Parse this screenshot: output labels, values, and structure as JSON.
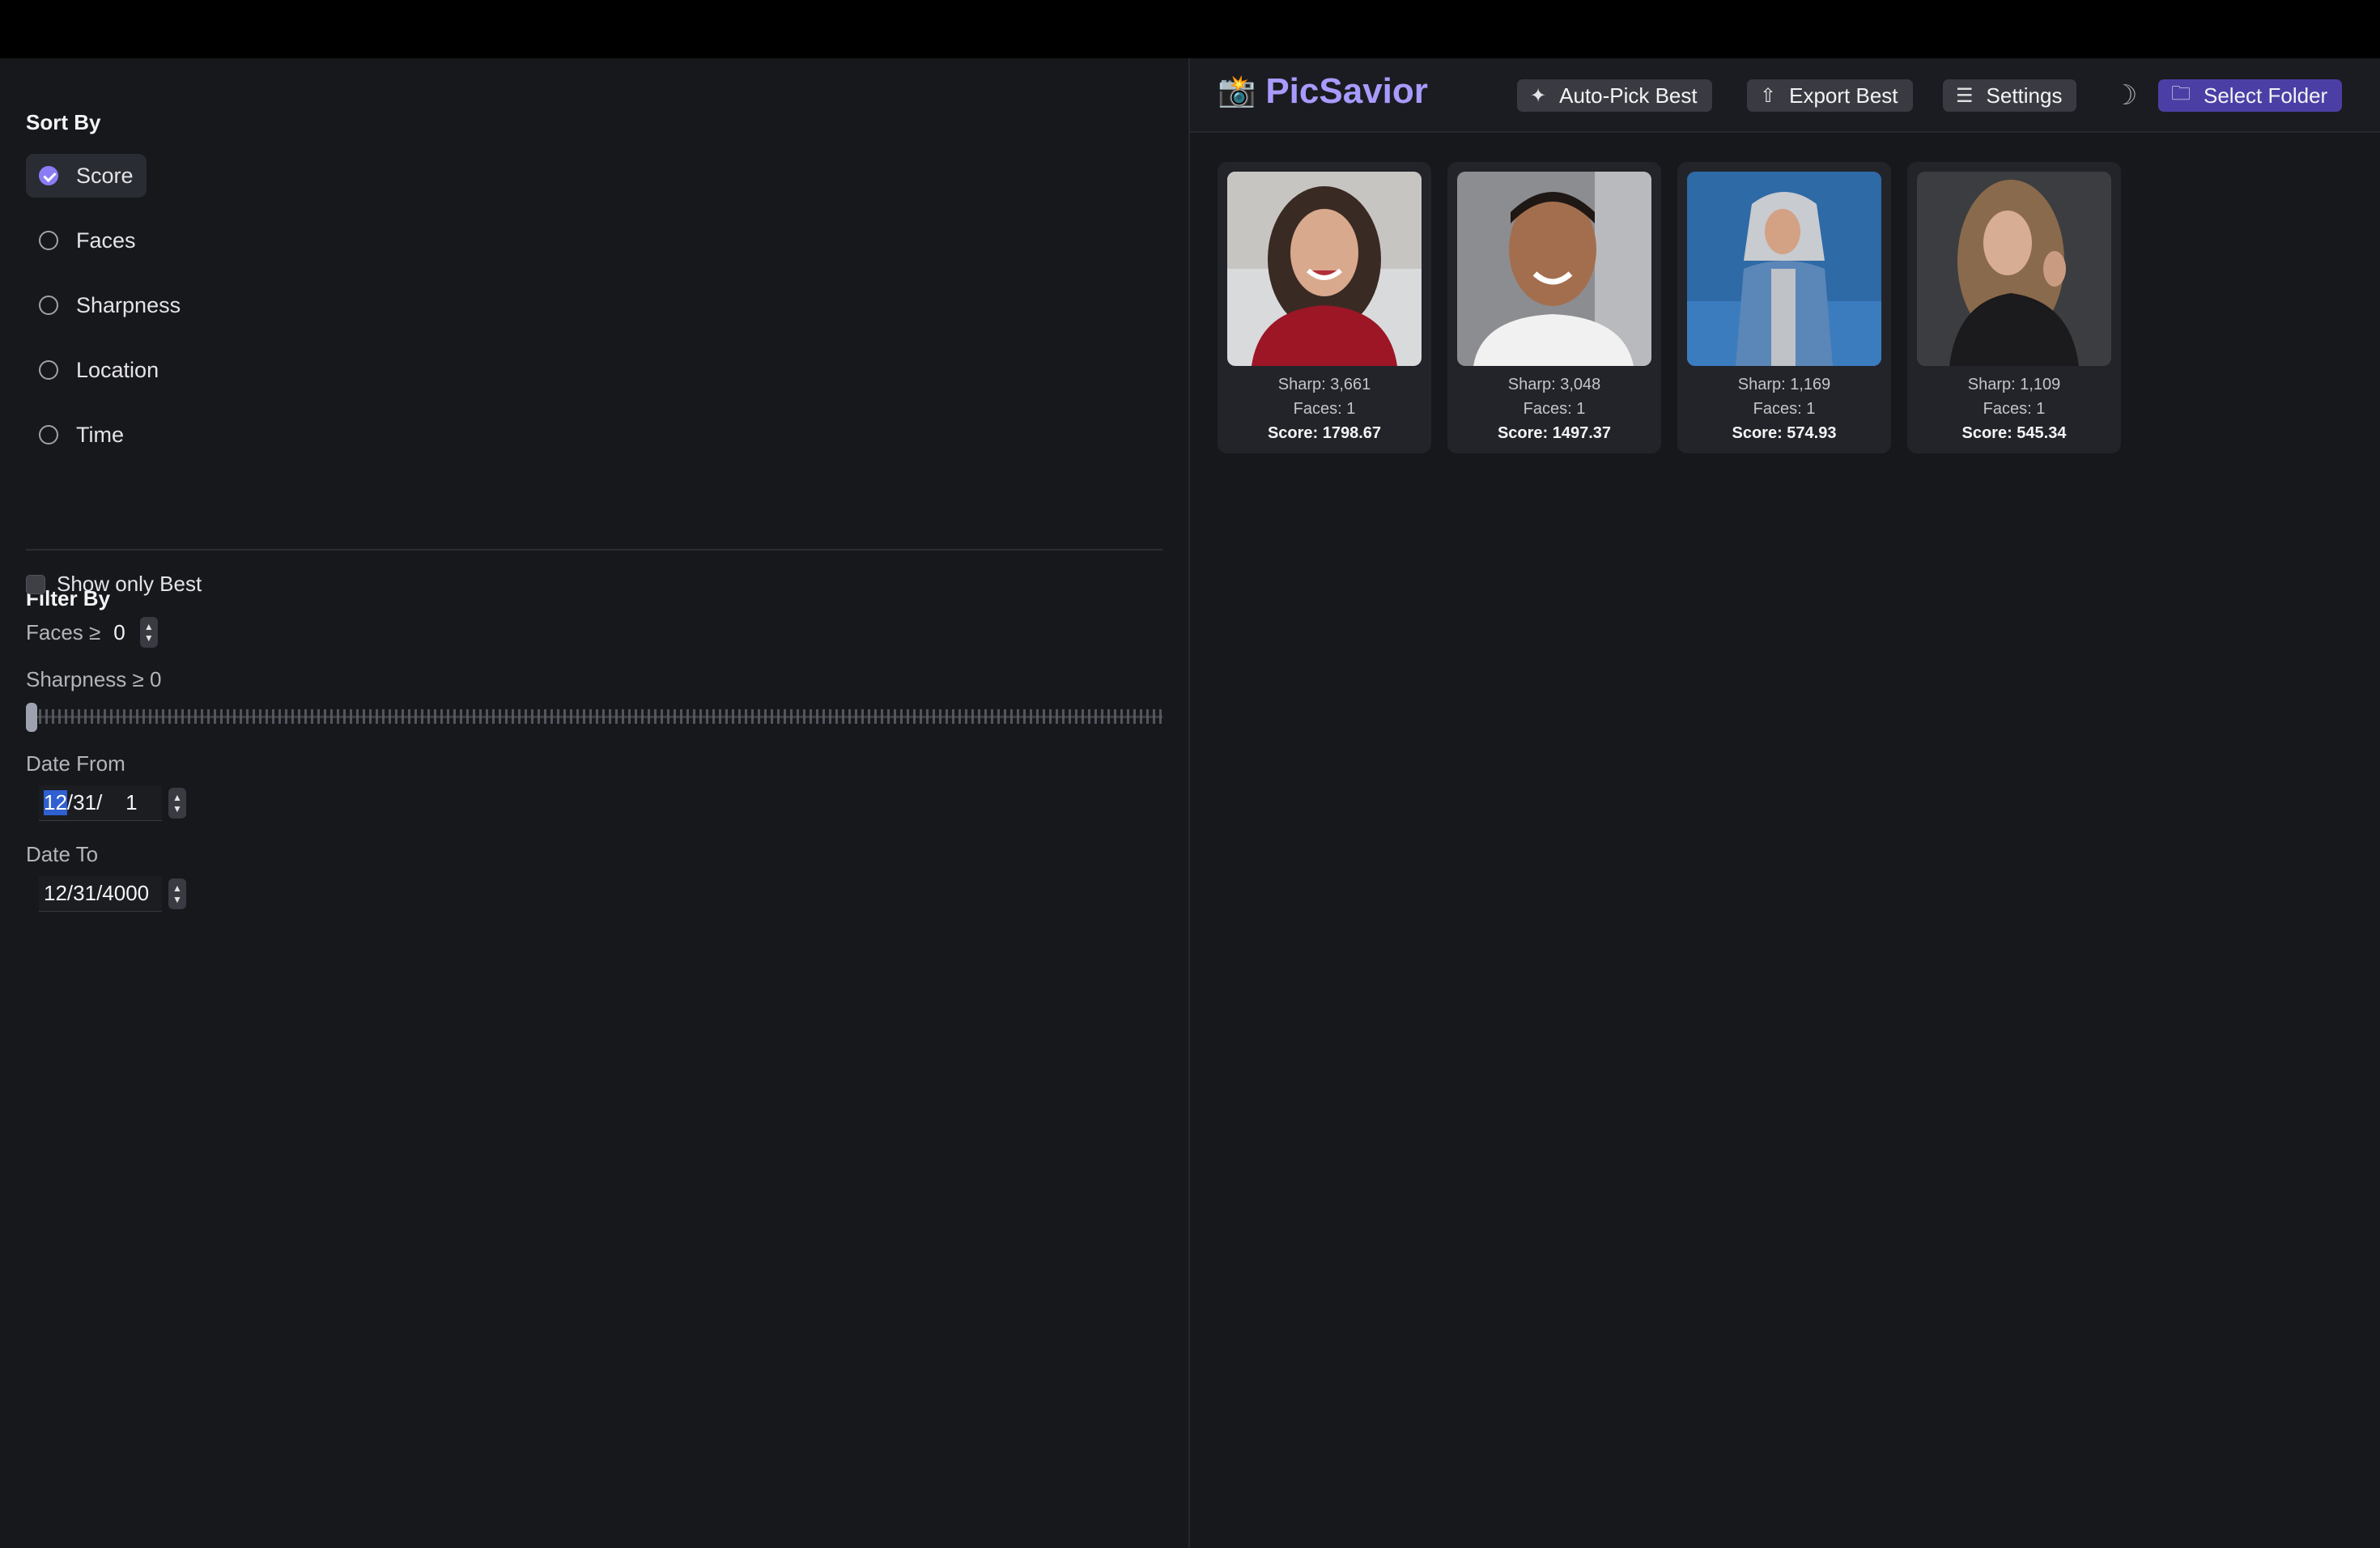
{
  "app": {
    "name": "PicSavior",
    "logo_icon": "camera-flash-icon"
  },
  "header": {
    "buttons": [
      {
        "label": "Auto-Pick Best",
        "icon": "sparkles-icon"
      },
      {
        "label": "Export Best",
        "icon": "share-icon"
      },
      {
        "label": "Settings",
        "icon": "sliders-icon"
      },
      {
        "label": "Select Folder",
        "icon": "folder-icon"
      }
    ],
    "theme_icon": "moon-icon"
  },
  "sidebar": {
    "sort_title": "Sort By",
    "sort_options": [
      {
        "label": "Score",
        "selected": true
      },
      {
        "label": "Faces",
        "selected": false
      },
      {
        "label": "Sharpness",
        "selected": false
      },
      {
        "label": "Location",
        "selected": false
      },
      {
        "label": "Time",
        "selected": false
      }
    ],
    "filter_title": "Filter By",
    "show_only_best_label": "Show only Best",
    "show_only_best_checked": false,
    "faces_label": "Faces ≥",
    "faces_value": "0",
    "sharpness_label": "Sharpness ≥ 0",
    "sharpness_value": 0,
    "date_from_label": "Date From",
    "date_from_month": "12",
    "date_from_rest": "/31/    1",
    "date_to_label": "Date To",
    "date_to_value": "12/31/4000"
  },
  "photos": [
    {
      "sharp": "Sharp: 3,661",
      "faces": "Faces: 1",
      "score": "Score: 1798.67"
    },
    {
      "sharp": "Sharp: 3,048",
      "faces": "Faces: 1",
      "score": "Score: 1497.37"
    },
    {
      "sharp": "Sharp: 1,169",
      "faces": "Faces: 1",
      "score": "Score: 574.93"
    },
    {
      "sharp": "Sharp: 1,109",
      "faces": "Faces: 1",
      "score": "Score: 545.34"
    }
  ],
  "colors": {
    "accent": "#a79bff",
    "primary_button": "#4b3fa6",
    "selection": "#2f5fd0"
  }
}
